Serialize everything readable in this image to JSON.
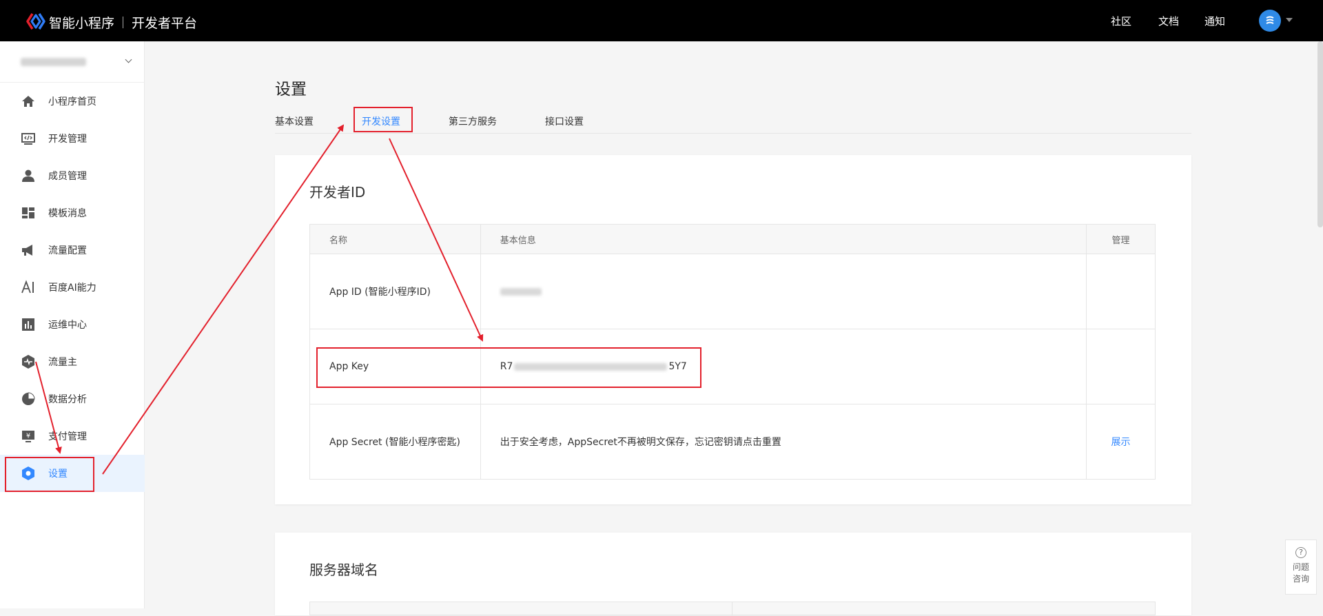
{
  "header": {
    "brand_name": "智能小程序",
    "platform_name": "开发者平台",
    "nav": [
      "社区",
      "文档",
      "通知"
    ]
  },
  "sidebar": {
    "items": [
      {
        "label": "小程序首页",
        "icon": "home-icon"
      },
      {
        "label": "开发管理",
        "icon": "code-icon"
      },
      {
        "label": "成员管理",
        "icon": "user-icon"
      },
      {
        "label": "模板消息",
        "icon": "template-icon"
      },
      {
        "label": "流量配置",
        "icon": "megaphone-icon"
      },
      {
        "label": "百度AI能力",
        "icon": "ai-icon"
      },
      {
        "label": "运维中心",
        "icon": "chart-icon"
      },
      {
        "label": "流量主",
        "icon": "hexagon-pulse-icon"
      },
      {
        "label": "数据分析",
        "icon": "pie-icon"
      },
      {
        "label": "支付管理",
        "icon": "payment-icon"
      },
      {
        "label": "设置",
        "icon": "settings-icon",
        "active": true
      }
    ]
  },
  "main": {
    "title": "设置",
    "tabs": [
      "基本设置",
      "开发设置",
      "第三方服务",
      "接口设置"
    ],
    "active_tab": "开发设置",
    "developer_id": {
      "title": "开发者ID",
      "columns": [
        "名称",
        "基本信息",
        "管理"
      ],
      "rows": [
        {
          "name": "App ID (智能小程序ID)",
          "info": "",
          "action": ""
        },
        {
          "name": "App Key",
          "info_prefix": "R7",
          "info_suffix": "5Y7",
          "action": ""
        },
        {
          "name": "App Secret (智能小程序密匙)",
          "info": "出于安全考虑，AppSecret不再被明文保存，忘记密钥请点击重置",
          "action": "展示"
        }
      ]
    },
    "server_domain": {
      "title": "服务器域名"
    }
  },
  "help": {
    "label_line1": "问题",
    "label_line2": "咨询",
    "icon": "question-icon"
  },
  "colors": {
    "accent": "#3388ff",
    "highlight": "#e3202c"
  }
}
